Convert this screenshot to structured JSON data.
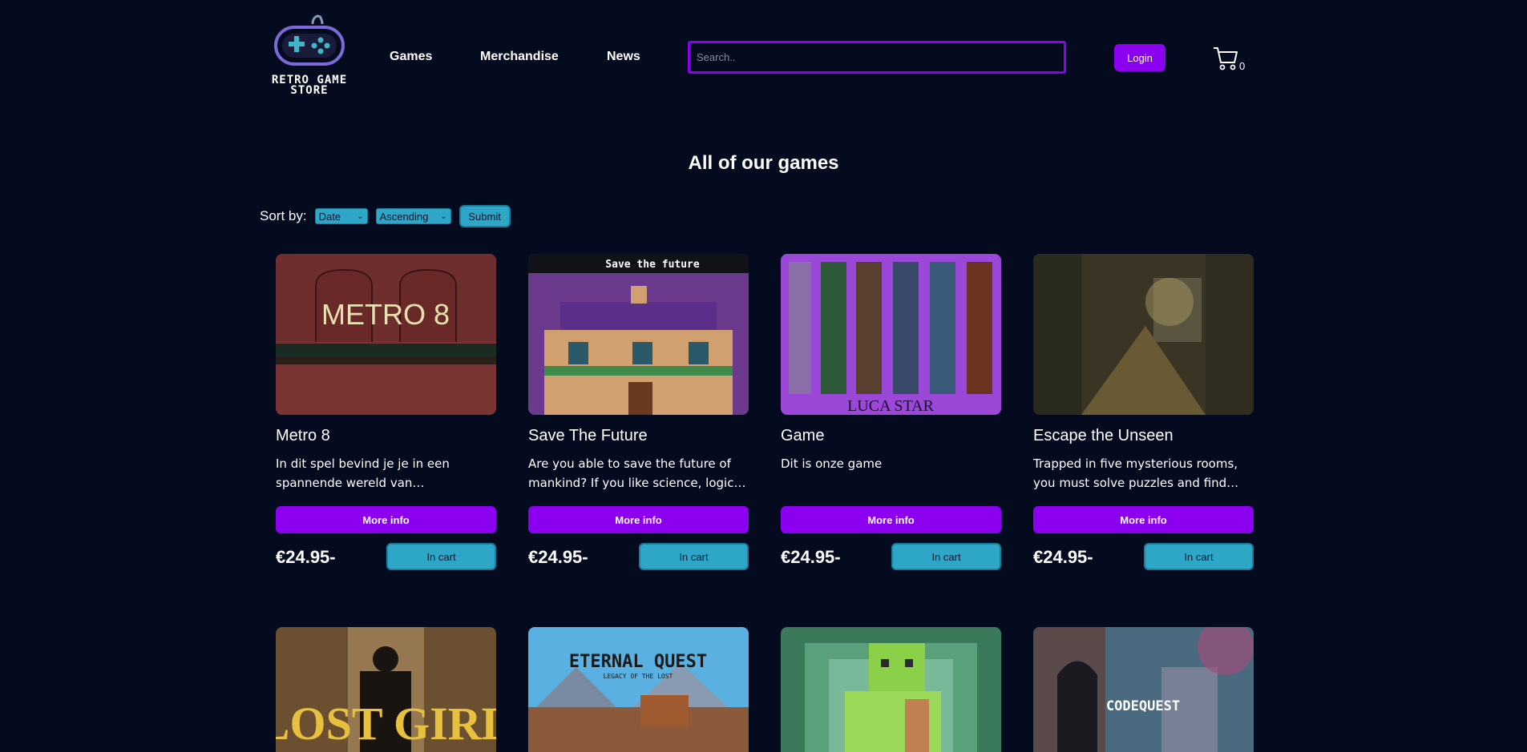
{
  "header": {
    "logo_line1": "RETRO GAME",
    "logo_line2": "STORE",
    "nav": [
      {
        "label": "Games"
      },
      {
        "label": "Merchandise"
      },
      {
        "label": "News"
      }
    ],
    "search_placeholder": "Search..",
    "login_label": "Login",
    "cart_count": "0"
  },
  "page_title": "All of our games",
  "sort": {
    "label": "Sort by:",
    "field_value": "Date",
    "order_value": "Ascending",
    "submit_label": "Submit"
  },
  "games": [
    {
      "title": "Metro 8",
      "description": "In dit spel bevind je je in een spannende wereld van ondergrondse metrostations",
      "more_label": "More info",
      "price": "€24.95-",
      "cart_label": "In cart",
      "image_text": "METRO 8"
    },
    {
      "title": "Save The Future",
      "description": "Are you able to save the future of mankind? If you like science, logical puzzles",
      "more_label": "More info",
      "price": "€24.95-",
      "cart_label": "In cart",
      "image_text": "Save the future"
    },
    {
      "title": "Game",
      "description": "Dit is onze game",
      "more_label": "More info",
      "price": "€24.95-",
      "cart_label": "In cart",
      "image_text": "LUCA STAR"
    },
    {
      "title": "Escape the Unseen",
      "description": "Trapped in five mysterious rooms, you must solve puzzles and find your way out",
      "more_label": "More info",
      "price": "€24.95-",
      "cart_label": "In cart",
      "image_text": ""
    },
    {
      "image_text": "LOST GIRL"
    },
    {
      "image_text": "ETERNAL QUEST",
      "image_subtext": "LEGACY OF THE LOST"
    },
    {
      "image_text": ""
    },
    {
      "image_text": "CODEQUEST"
    }
  ]
}
